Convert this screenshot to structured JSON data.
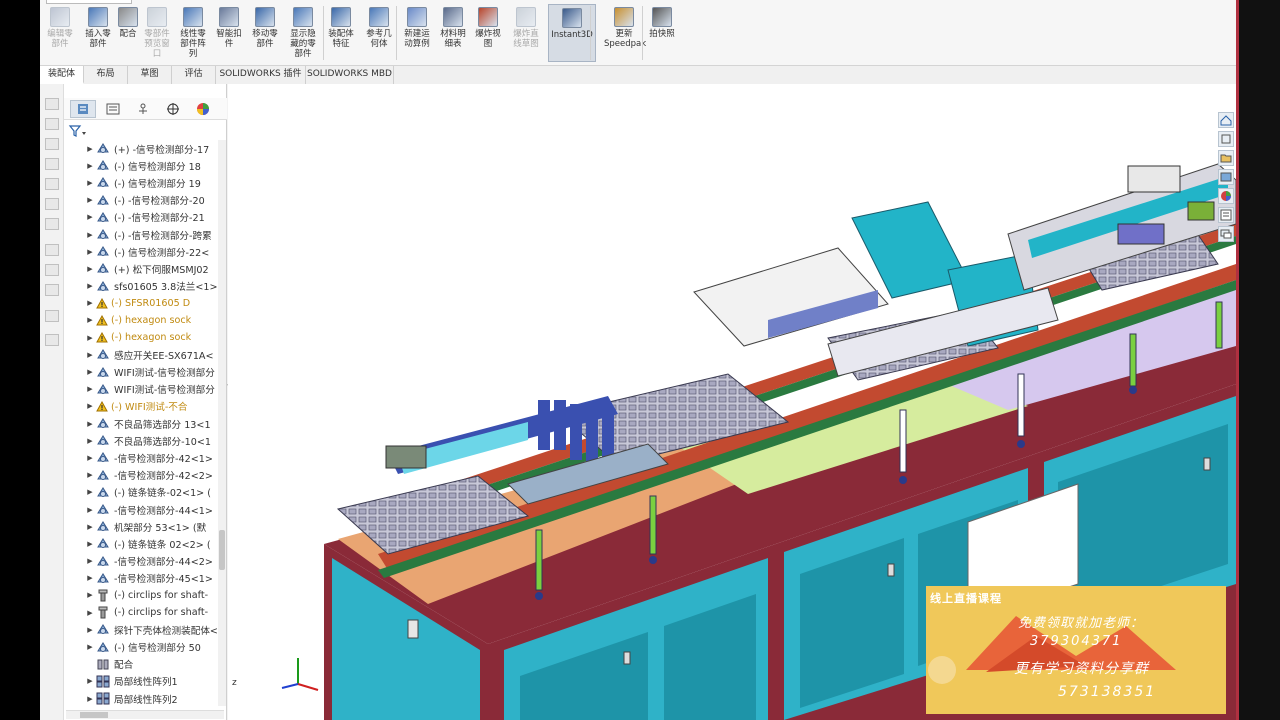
{
  "ribbon": {
    "buttons": [
      {
        "label": "编辑零\n部件",
        "icon": "edit-component-icon",
        "disabled": true
      },
      {
        "label": "插入零\n部件",
        "icon": "insert-component-icon",
        "disabled": false
      },
      {
        "label": "配合",
        "icon": "mate-icon",
        "disabled": false
      },
      {
        "label": "零部件\n预览窗\n口",
        "icon": "component-preview-icon",
        "disabled": true
      },
      {
        "label": "线性零\n部件阵\n列",
        "icon": "linear-pattern-icon",
        "disabled": false
      },
      {
        "label": "智能扣\n件",
        "icon": "smart-fasteners-icon",
        "disabled": false
      },
      {
        "label": "移动零\n部件",
        "icon": "move-component-icon",
        "disabled": false
      },
      {
        "label": "显示隐\n藏的零\n部件",
        "icon": "show-hidden-icon",
        "disabled": false
      },
      {
        "label": "装配体\n特征",
        "icon": "assembly-feature-icon",
        "disabled": false
      },
      {
        "label": "参考几\n何体",
        "icon": "reference-geometry-icon",
        "disabled": false
      },
      {
        "label": "新建运\n动算例",
        "icon": "motion-study-icon",
        "disabled": false
      },
      {
        "label": "材料明\n细表",
        "icon": "bom-icon",
        "disabled": false
      },
      {
        "label": "爆炸视\n图",
        "icon": "exploded-view-icon",
        "disabled": false
      },
      {
        "label": "爆炸直\n线草图",
        "icon": "explode-line-icon",
        "disabled": true
      },
      {
        "label": "Instant3D",
        "icon": "instant3d-icon",
        "disabled": false,
        "active": true
      },
      {
        "label": "更新\nSpeedpak",
        "icon": "speedpak-icon",
        "disabled": false
      },
      {
        "label": "拍快照",
        "icon": "snapshot-icon",
        "disabled": false
      }
    ]
  },
  "tabs": [
    "装配体",
    "布局",
    "草图",
    "评估",
    "SOLIDWORKS 插件",
    "SOLIDWORKS MBD"
  ],
  "tree": {
    "items": [
      {
        "label": "(+) -信号检测部分-17",
        "type": "asm"
      },
      {
        "label": "(-) 信号检测部分 18",
        "type": "asm"
      },
      {
        "label": "(-) 信号检测部分 19",
        "type": "asm"
      },
      {
        "label": "(-) -信号检测部分-20",
        "type": "asm"
      },
      {
        "label": "(-) -信号检测部分-21",
        "type": "asm"
      },
      {
        "label": "(-) -信号检测部分-跨累",
        "type": "asm"
      },
      {
        "label": "(-) 信号检测部分-22<",
        "type": "asm"
      },
      {
        "label": "(+) 松下伺服MSMJ02",
        "type": "asm"
      },
      {
        "label": "sfs01605 3.8法兰<1>",
        "type": "asm"
      },
      {
        "label": "(-) SFSR01605 D",
        "type": "asm-warn",
        "warn": true
      },
      {
        "label": "(-) hexagon sock",
        "type": "part-warn",
        "warn": true
      },
      {
        "label": "(-) hexagon sock",
        "type": "part-warn",
        "warn": true
      },
      {
        "label": "感应开关EE-SX671A<",
        "type": "asm"
      },
      {
        "label": "WIFI测试-信号检测部分",
        "type": "asm"
      },
      {
        "label": "WIFI测试-信号检测部分",
        "type": "asm"
      },
      {
        "label": "(-) WIFI测试-不合",
        "type": "asm-warn",
        "warn": true
      },
      {
        "label": "不良品筛选部分 13<1",
        "type": "asm"
      },
      {
        "label": "不良品筛选部分-10<1",
        "type": "asm"
      },
      {
        "label": "-信号检测部分-42<1>",
        "type": "asm"
      },
      {
        "label": "-信号检测部分-42<2>",
        "type": "asm"
      },
      {
        "label": "(-) 链条链条-02<1> (",
        "type": "asm"
      },
      {
        "label": "-信号检测部分-44<1>",
        "type": "asm"
      },
      {
        "label": "机架部分 53<1> (默",
        "type": "asm"
      },
      {
        "label": "(-) 链条链条 02<2> (",
        "type": "asm"
      },
      {
        "label": "-信号检测部分-44<2>",
        "type": "asm"
      },
      {
        "label": "-信号检测部分-45<1>",
        "type": "asm"
      },
      {
        "label": "(-) circlips for shaft-",
        "type": "part"
      },
      {
        "label": "(-) circlips for shaft-",
        "type": "part"
      },
      {
        "label": "探针下壳体检测装配体<",
        "type": "asm"
      },
      {
        "label": "(-) 信号检测部分 50",
        "type": "asm"
      },
      {
        "label": "配合",
        "type": "mates",
        "noarrow": true
      },
      {
        "label": "局部线性阵列1",
        "type": "pattern"
      },
      {
        "label": "局部线性阵列2",
        "type": "pattern"
      }
    ]
  },
  "viewport": {
    "window_controls": [
      "⊡",
      "▭",
      "⧉",
      "▭",
      "✕"
    ],
    "triad_axis": "z"
  },
  "promo": {
    "title": "线上直播课程",
    "line1": "免费领取就加老师：",
    "line2": "379304371",
    "line3": "更有学习资料分享群",
    "line4": "573138351"
  },
  "colors": {
    "frame": "#9a2a38",
    "panel_cyan": "#2ab0c8",
    "base_plate": "#e8a070",
    "belt": "#c04030",
    "promo_bg": "#f0c85a"
  }
}
